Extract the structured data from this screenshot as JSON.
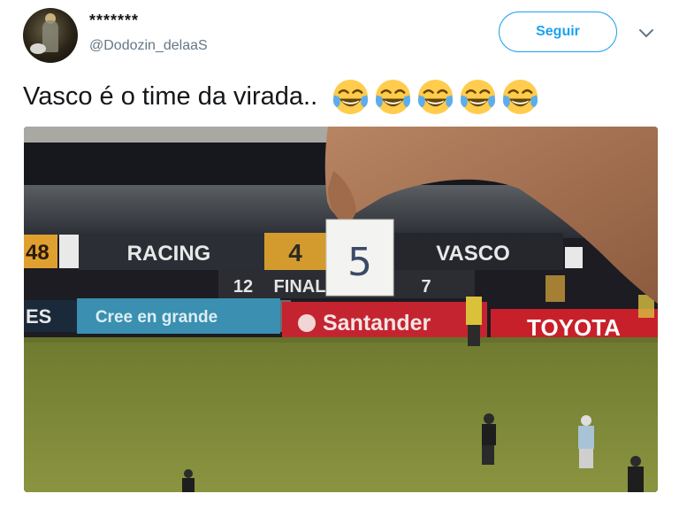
{
  "user": {
    "display_name": "*******",
    "handle": "@Dodozin_delaaS"
  },
  "follow_label": "Seguir",
  "tweet_text": "Vasco é o time da virada..",
  "emoji_name": "face-with-tears-of-joy",
  "emoji_count": 5,
  "media": {
    "scoreboard": {
      "left_number": "48",
      "home_team": "RACING",
      "home_score": "4",
      "away_team": "VASCO",
      "paper_score": "5",
      "clock_left": "12",
      "status": "FINAL",
      "clock_right": "7"
    },
    "ads": {
      "left_fragment": "ES",
      "slogan": "Cree en grande",
      "sponsor1": "Santander",
      "sponsor2": "TOYOTA"
    }
  },
  "colors": {
    "accent": "#1da1f2",
    "secondary_text": "#657786",
    "pitch": "#7f8a3a",
    "santander_red": "#cc1f2a",
    "toyota_red": "#c8202b"
  }
}
